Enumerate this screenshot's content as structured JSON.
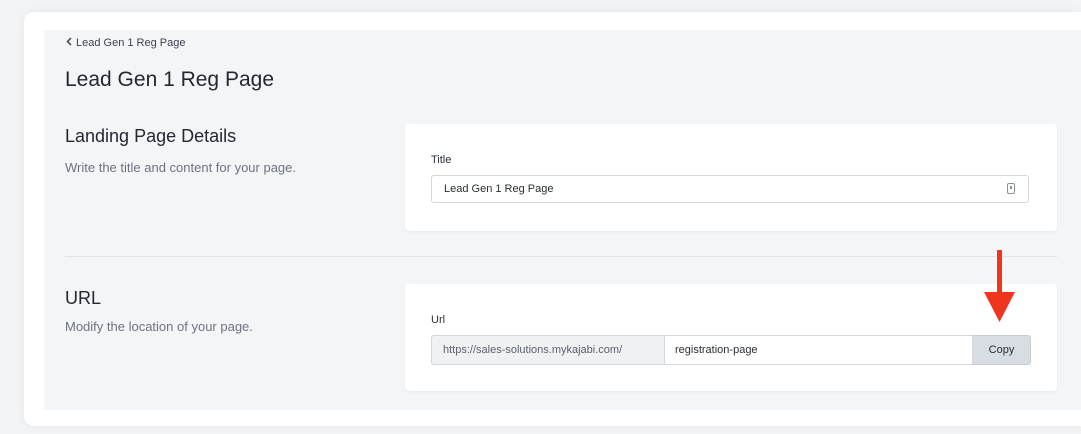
{
  "breadcrumb": {
    "back_label": "Lead Gen 1 Reg Page"
  },
  "page": {
    "title": "Lead Gen 1 Reg Page"
  },
  "details_section": {
    "heading": "Landing Page Details",
    "description": "Write the title and content for your page.",
    "title_field": {
      "label": "Title",
      "value": "Lead Gen 1 Reg Page"
    }
  },
  "url_section": {
    "heading": "URL",
    "description": "Modify the location of your page.",
    "url_field": {
      "label": "Url",
      "prefix": "https://sales-solutions.mykajabi.com/",
      "slug": "registration-page",
      "copy_label": "Copy"
    }
  },
  "colors": {
    "annotation_arrow": "#f0351e",
    "copy_button_bg": "#d8dde3"
  }
}
